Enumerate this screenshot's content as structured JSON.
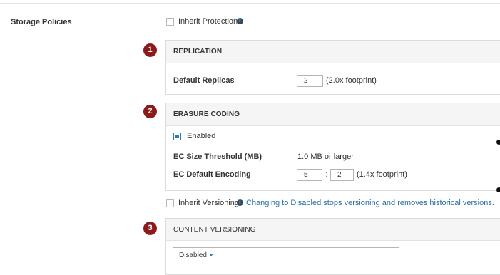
{
  "storage_policies": {
    "label": "Storage Policies"
  },
  "inherit_protection": {
    "label": "Inherit Protection",
    "checked": false
  },
  "badges": [
    "1",
    "2",
    "3"
  ],
  "replication": {
    "title": "REPLICATION",
    "default_replicas_label": "Default Replicas",
    "default_replicas_value": "2",
    "footprint": "(2.0x footprint)"
  },
  "erasure_coding": {
    "title": "ERASURE CODING",
    "enabled_label": "Enabled",
    "enabled_checked": true,
    "threshold_label": "EC Size Threshold (MB)",
    "threshold_value": "1.0 MB or larger",
    "encoding_label": "EC Default Encoding",
    "encoding_data": "5",
    "encoding_separator": ":",
    "encoding_parity": "2",
    "footprint": "(1.4x footprint)"
  },
  "inherit_versioning": {
    "label": "Inherit Versioning",
    "checked": false,
    "warning": "Changing to Disabled stops versioning and removes historical versions."
  },
  "content_versioning": {
    "title": "CONTENT VERSIONING",
    "selected": "Disabled"
  },
  "colors": {
    "badge": "#8b1a1a",
    "accent": "#2a7bb8",
    "info_icon": "#2d4b5d",
    "warning_text": "#2a6fa8"
  },
  "icons": {
    "info": "info-icon",
    "dropdown": "caret-down-icon"
  }
}
